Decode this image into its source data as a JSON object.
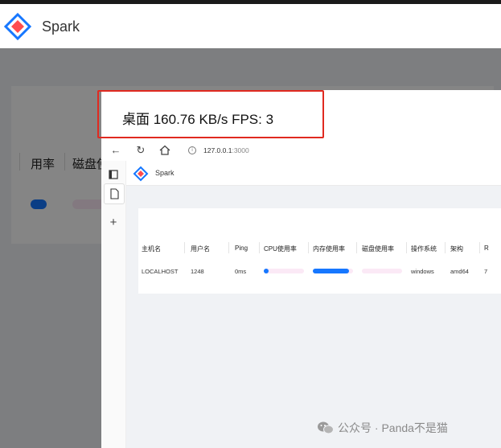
{
  "app": {
    "title": "Spark"
  },
  "background_table": {
    "columns": [
      "用率",
      "磁盘使"
    ]
  },
  "desktop": {
    "title": "桌面 160.76 KB/s FPS: 3"
  },
  "browser": {
    "url_host": "127.0.0.1",
    "url_port": ":3000"
  },
  "inner_app": {
    "title": "Spark",
    "table": {
      "headers": [
        "主机名",
        "用户名",
        "Ping",
        "CPU使用率",
        "内存使用率",
        "磁盘使用率",
        "操作系统",
        "架构",
        "R"
      ],
      "row": {
        "hostname": "LOCALHOST",
        "username": "1248",
        "ping": "0ms",
        "cpu_usage": 0.06,
        "memory_usage": 0.9,
        "disk_usage": 0.0,
        "os": "windows",
        "arch": "amd64",
        "extra": "7"
      }
    }
  },
  "watermark": {
    "text": "公众号 · Panda不是猫",
    "icon": "wechat-icon"
  },
  "colors": {
    "accent": "#1890ff",
    "bar_track": "#fbe9f6",
    "highlight_border": "#e02a20"
  }
}
